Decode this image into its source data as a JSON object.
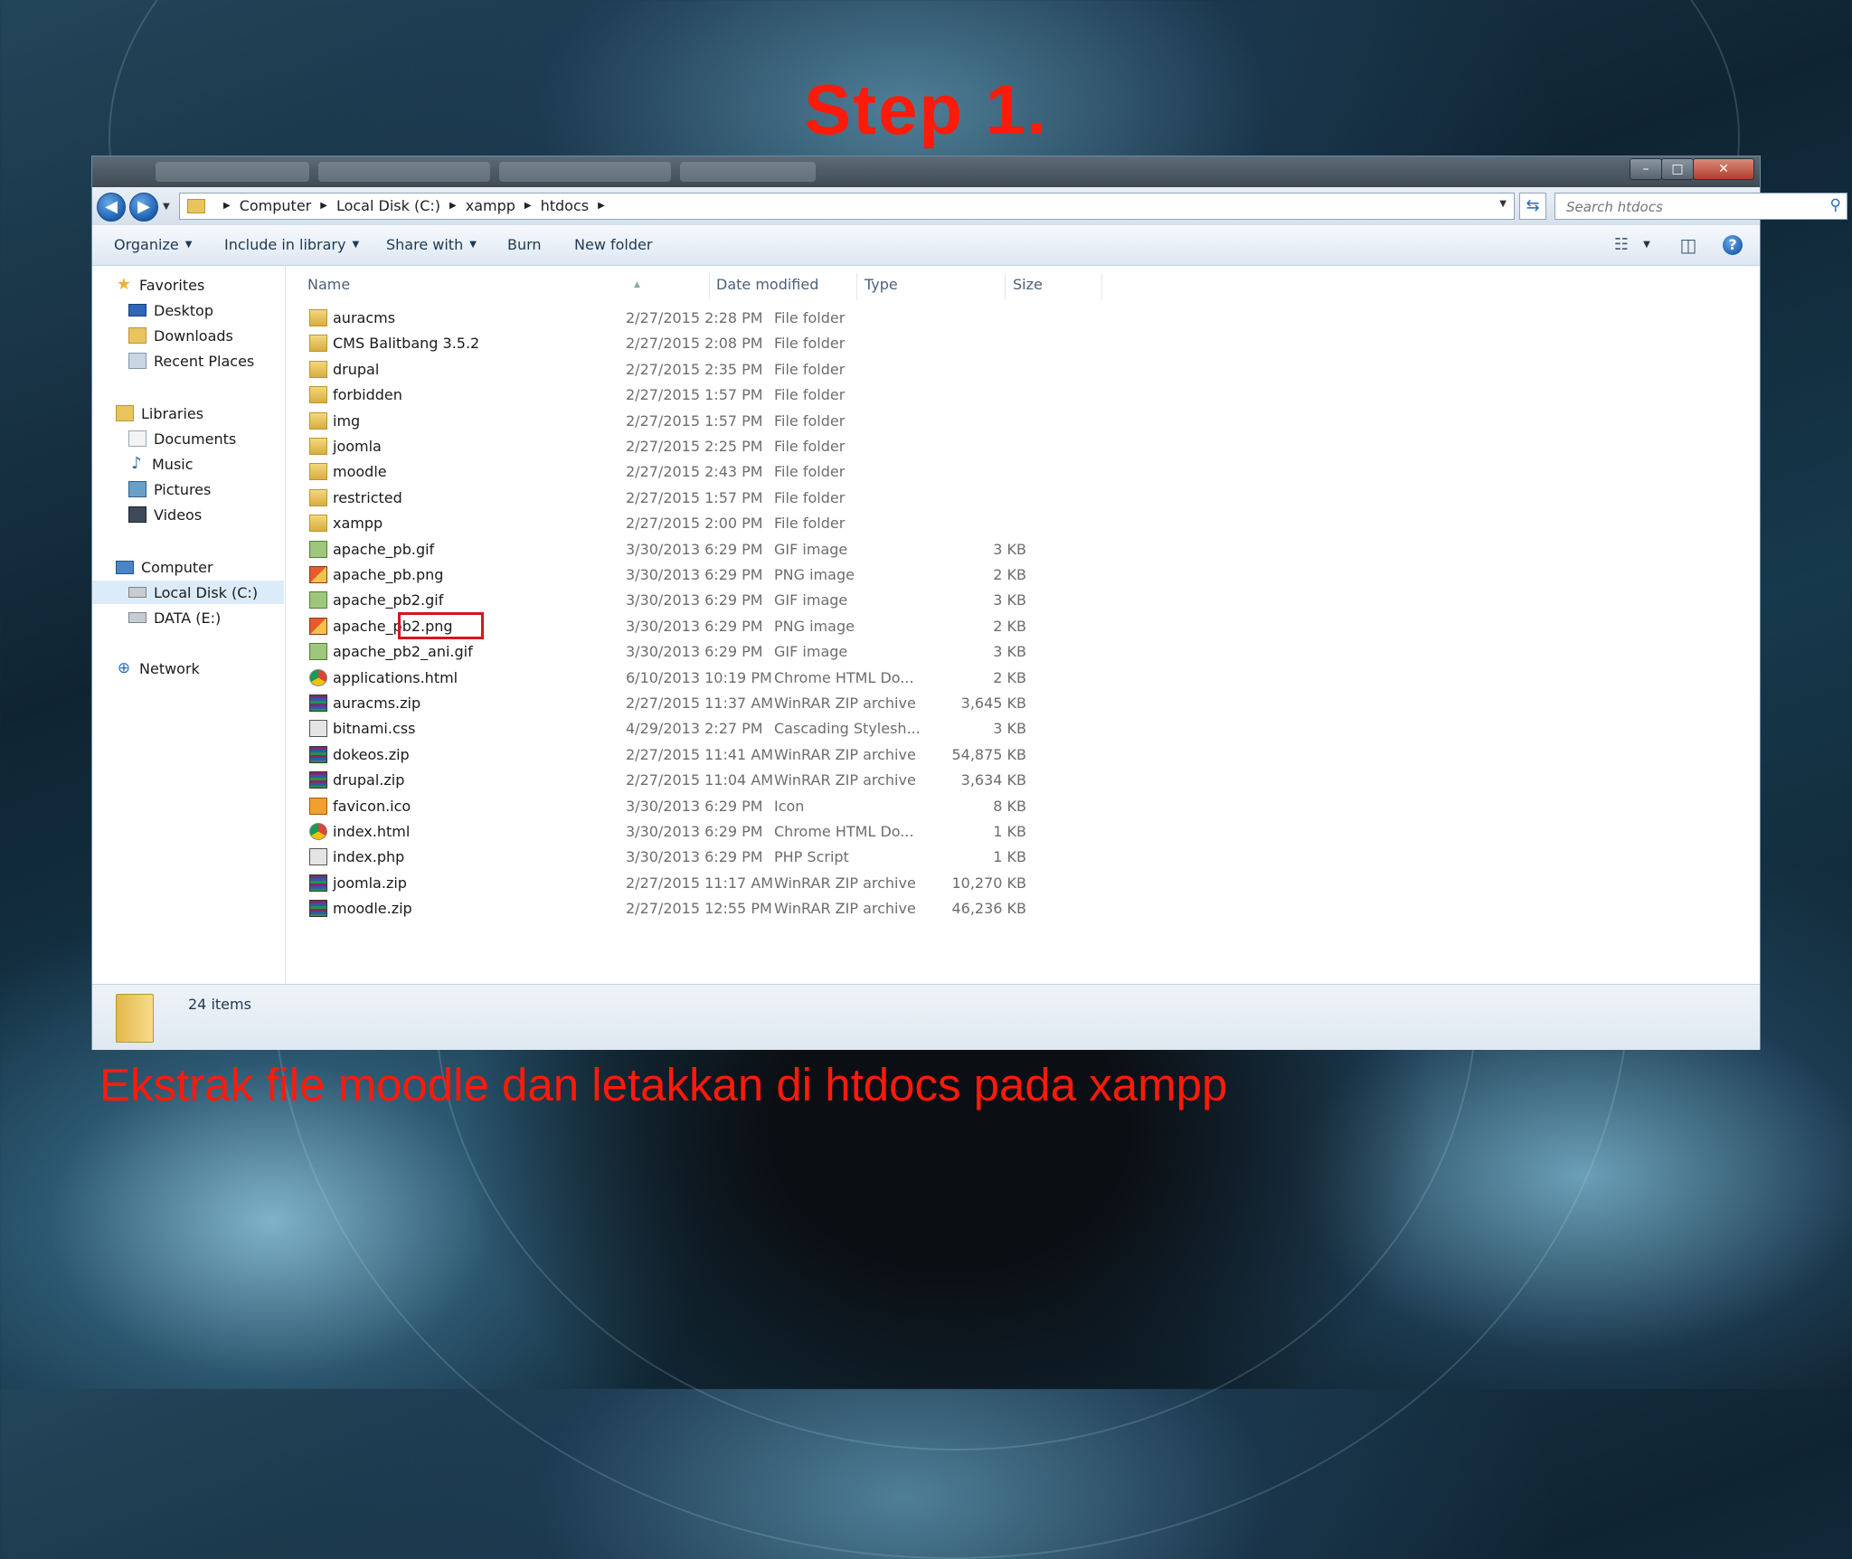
{
  "slide": {
    "title": "Step 1.",
    "caption": "Ekstrak file moodle dan letakkan di htdocs pada xampp"
  },
  "window": {
    "controls": {
      "minimize": "–",
      "maximize": "□",
      "close": "✕"
    },
    "breadcrumb": [
      "Computer",
      "Local Disk (C:)",
      "xampp",
      "htdocs"
    ],
    "search_placeholder": "Search htdocs",
    "toolbar": {
      "organize": "Organize",
      "include_in_library": "Include in library",
      "share_with": "Share with",
      "burn": "Burn",
      "new_folder": "New folder"
    },
    "nav": {
      "favorites": "Favorites",
      "desktop": "Desktop",
      "downloads": "Downloads",
      "recent_places": "Recent Places",
      "libraries": "Libraries",
      "documents": "Documents",
      "music": "Music",
      "pictures": "Pictures",
      "videos": "Videos",
      "computer": "Computer",
      "local_disk": "Local Disk (C:)",
      "data_drive": "DATA (E:)",
      "network": "Network"
    },
    "columns": {
      "name": "Name",
      "date_modified": "Date modified",
      "type": "Type",
      "size": "Size"
    },
    "files": [
      {
        "name": "auracms",
        "date": "2/27/2015 2:28 PM",
        "type": "File folder",
        "size": "",
        "icon": "folder"
      },
      {
        "name": "CMS Balitbang 3.5.2",
        "date": "2/27/2015 2:08 PM",
        "type": "File folder",
        "size": "",
        "icon": "folder"
      },
      {
        "name": "drupal",
        "date": "2/27/2015 2:35 PM",
        "type": "File folder",
        "size": "",
        "icon": "folder"
      },
      {
        "name": "forbidden",
        "date": "2/27/2015 1:57 PM",
        "type": "File folder",
        "size": "",
        "icon": "folder"
      },
      {
        "name": "img",
        "date": "2/27/2015 1:57 PM",
        "type": "File folder",
        "size": "",
        "icon": "folder"
      },
      {
        "name": "joomla",
        "date": "2/27/2015 2:25 PM",
        "type": "File folder",
        "size": "",
        "icon": "folder"
      },
      {
        "name": "moodle",
        "date": "2/27/2015 2:43 PM",
        "type": "File folder",
        "size": "",
        "icon": "folder"
      },
      {
        "name": "restricted",
        "date": "2/27/2015 1:57 PM",
        "type": "File folder",
        "size": "",
        "icon": "folder"
      },
      {
        "name": "xampp",
        "date": "2/27/2015 2:00 PM",
        "type": "File folder",
        "size": "",
        "icon": "folder"
      },
      {
        "name": "apache_pb.gif",
        "date": "3/30/2013 6:29 PM",
        "type": "GIF image",
        "size": "3 KB",
        "icon": "gif"
      },
      {
        "name": "apache_pb.png",
        "date": "3/30/2013 6:29 PM",
        "type": "PNG image",
        "size": "2 KB",
        "icon": "png"
      },
      {
        "name": "apache_pb2.gif",
        "date": "3/30/2013 6:29 PM",
        "type": "GIF image",
        "size": "3 KB",
        "icon": "gif"
      },
      {
        "name": "apache_pb2.png",
        "date": "3/30/2013 6:29 PM",
        "type": "PNG image",
        "size": "2 KB",
        "icon": "png"
      },
      {
        "name": "apache_pb2_ani.gif",
        "date": "3/30/2013 6:29 PM",
        "type": "GIF image",
        "size": "3 KB",
        "icon": "gif"
      },
      {
        "name": "applications.html",
        "date": "6/10/2013 10:19 PM",
        "type": "Chrome HTML Do...",
        "size": "2 KB",
        "icon": "chrome"
      },
      {
        "name": "auracms.zip",
        "date": "2/27/2015 11:37 AM",
        "type": "WinRAR ZIP archive",
        "size": "3,645 KB",
        "icon": "rar"
      },
      {
        "name": "bitnami.css",
        "date": "4/29/2013 2:27 PM",
        "type": "Cascading Stylesh...",
        "size": "3 KB",
        "icon": "css"
      },
      {
        "name": "dokeos.zip",
        "date": "2/27/2015 11:41 AM",
        "type": "WinRAR ZIP archive",
        "size": "54,875 KB",
        "icon": "rar"
      },
      {
        "name": "drupal.zip",
        "date": "2/27/2015 11:04 AM",
        "type": "WinRAR ZIP archive",
        "size": "3,634 KB",
        "icon": "rar"
      },
      {
        "name": "favicon.ico",
        "date": "3/30/2013 6:29 PM",
        "type": "Icon",
        "size": "8 KB",
        "icon": "ico"
      },
      {
        "name": "index.html",
        "date": "3/30/2013 6:29 PM",
        "type": "Chrome HTML Do...",
        "size": "1 KB",
        "icon": "chrome"
      },
      {
        "name": "index.php",
        "date": "3/30/2013 6:29 PM",
        "type": "PHP Script",
        "size": "1 KB",
        "icon": "php"
      },
      {
        "name": "joomla.zip",
        "date": "2/27/2015 11:17 AM",
        "type": "WinRAR ZIP archive",
        "size": "10,270 KB",
        "icon": "rar"
      },
      {
        "name": "moodle.zip",
        "date": "2/27/2015 12:55 PM",
        "type": "WinRAR ZIP archive",
        "size": "46,236 KB",
        "icon": "rar"
      }
    ],
    "highlighted_file": "moodle",
    "status": {
      "item_count": "24 items"
    }
  },
  "colors": {
    "annotation_red": "#ff1a0a",
    "highlight_border": "#d8131a"
  }
}
